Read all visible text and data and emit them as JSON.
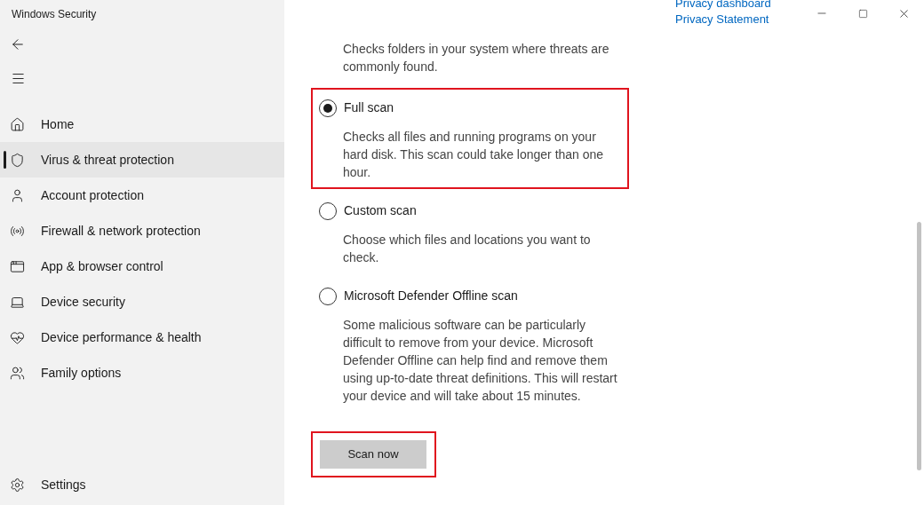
{
  "window": {
    "title": "Windows Security"
  },
  "sidebar": {
    "items": [
      {
        "label": "Home",
        "selected": false
      },
      {
        "label": "Virus & threat protection",
        "selected": true
      },
      {
        "label": "Account protection",
        "selected": false
      },
      {
        "label": "Firewall & network protection",
        "selected": false
      },
      {
        "label": "App & browser control",
        "selected": false
      },
      {
        "label": "Device security",
        "selected": false
      },
      {
        "label": "Device performance & health",
        "selected": false
      },
      {
        "label": "Family options",
        "selected": false
      }
    ],
    "settings": "Settings"
  },
  "links": [
    "Privacy dashboard",
    "Privacy Statement"
  ],
  "top_description": "Checks folders in your system where threats are commonly found.",
  "scan_options": [
    {
      "label": "Full scan",
      "description": "Checks all files and running programs on your hard disk. This scan could take longer than one hour.",
      "selected": true,
      "highlighted": true
    },
    {
      "label": "Custom scan",
      "description": "Choose which files and locations you want to check.",
      "selected": false,
      "highlighted": false
    },
    {
      "label": "Microsoft Defender Offline scan",
      "description": "Some malicious software can be particularly difficult to remove from your device. Microsoft Defender Offline can help find and remove them using up-to-date threat definitions. This will restart your device and will take about 15 minutes.",
      "selected": false,
      "highlighted": false
    }
  ],
  "scan_button": {
    "label": "Scan now",
    "highlighted": true
  }
}
